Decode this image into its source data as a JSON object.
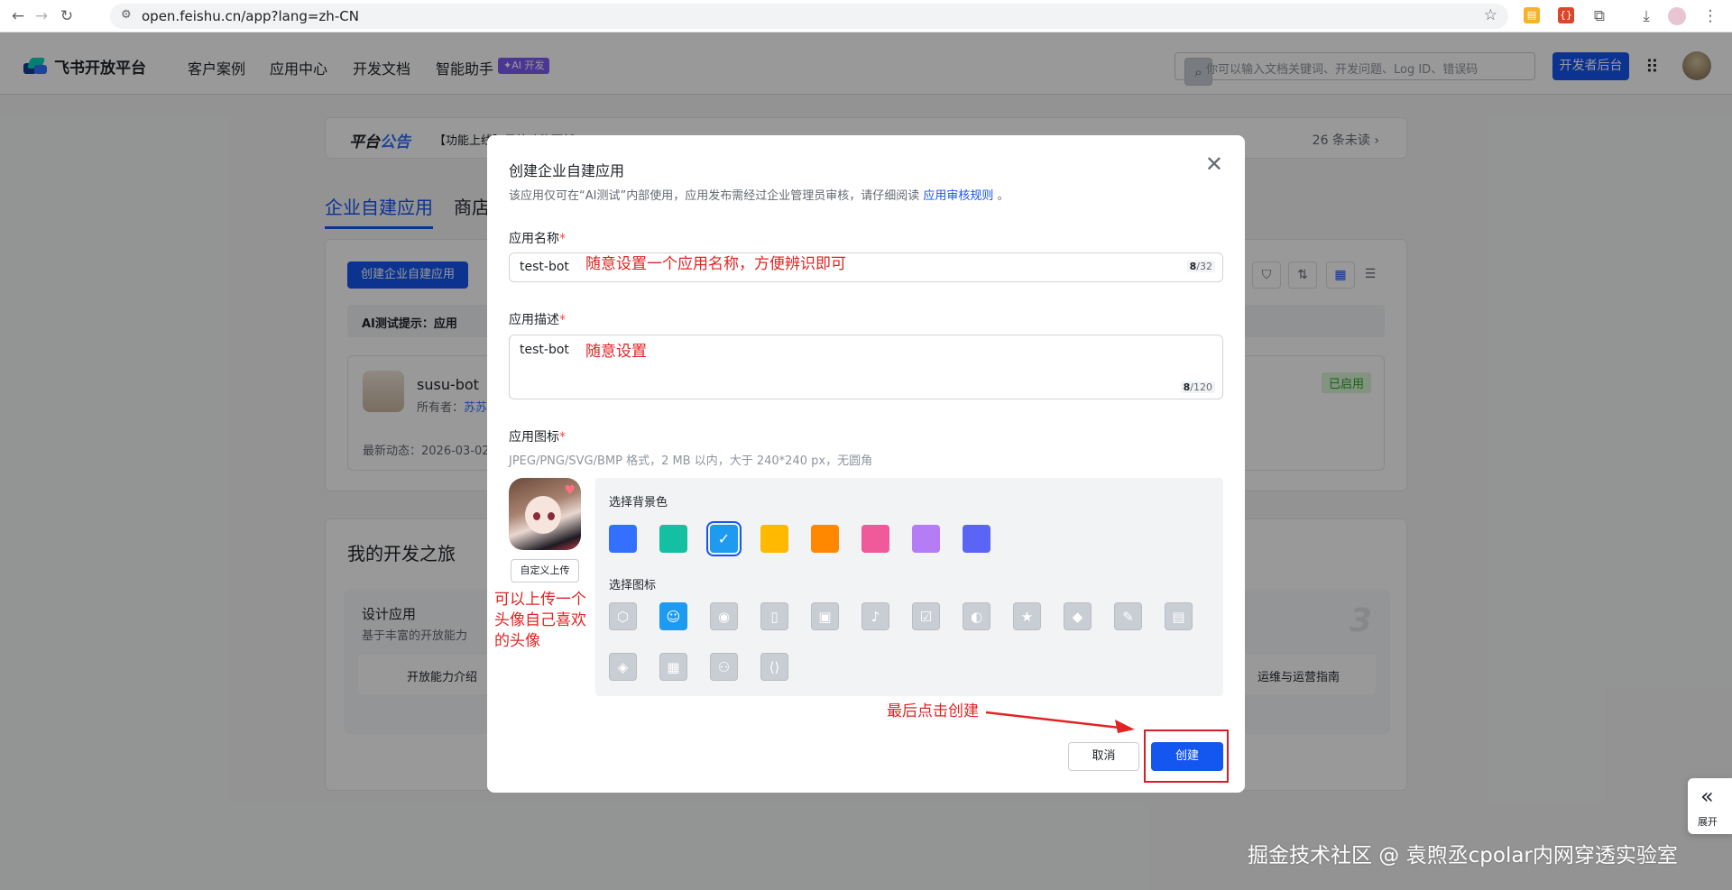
{
  "browser": {
    "url": "open.feishu.cn/app?lang=zh-CN",
    "icons": [
      "back-icon",
      "forward-icon",
      "reload-icon",
      "site-info-icon",
      "bookmark-star-icon",
      "extension-icon",
      "download-icon",
      "menu-icon"
    ]
  },
  "header": {
    "logo_text": "飞书开放平台",
    "nav": [
      "客户案例",
      "应用中心",
      "开发文档",
      "智能助手"
    ],
    "ai_badge": "✦AI 开发",
    "search_placeholder": "你可以输入文档关键词、开发问题、Log ID、错误码",
    "dev_console": "开发者后台"
  },
  "background": {
    "notice_title_a": "平台",
    "notice_title_b": "公告",
    "notice_text": "【功能上线】另外功能更新",
    "notice_count": "26 条未读 ›",
    "tab_active": "企业自建应用",
    "tab_other": "商店",
    "create_button": "创建企业自建应用",
    "tip_text": "AI测试提示：应用",
    "app": {
      "name": "susu-bot",
      "owner_label": "所有者：",
      "owner": "苏苏",
      "date": "最新动态：2026-03-02",
      "status": "已启用"
    },
    "journey_title": "我的开发之旅",
    "design_title": "设计应用",
    "design_desc": "基于丰富的开放能力",
    "link_left": "开放能力介绍",
    "link_right": "运维与运营指南",
    "step": "3"
  },
  "modal": {
    "title": "创建企业自建应用",
    "desc_text": "该应用仅可在“AI测试”内部使用，应用发布需经过企业管理员审核，请仔细阅读",
    "desc_link": "应用审核规则",
    "desc_end": "。",
    "name_label": "应用名称",
    "name_value": "test-bot",
    "name_count_cur": "8",
    "name_count_max": "/32",
    "desc_label": "应用描述",
    "desc_value": "test-bot",
    "desc_count_cur": "8",
    "desc_count_max": "/120",
    "icon_label": "应用图标",
    "icon_hint": "JPEG/PNG/SVG/BMP 格式，2 MB 以内，大于 240*240 px，无圆角",
    "upload_button": "自定义上传",
    "bg_label": "选择背景色",
    "icon_choose_label": "选择图标",
    "cancel": "取消",
    "create": "创建",
    "swatches": [
      "#3370ff",
      "#14c0a1",
      "#1e9bf0",
      "#ffba00",
      "#ff8800",
      "#f05a9a",
      "#b57cf5",
      "#5b65f5"
    ],
    "selected_swatch": 2,
    "selected_icon": "robot-icon",
    "icons": [
      "cube-icon",
      "robot-icon",
      "lightbulb-icon",
      "document-icon",
      "briefcase-icon",
      "bell-icon",
      "checklist-icon",
      "moon-icon",
      "star-icon",
      "tag-icon",
      "wrench-icon",
      "file-icon",
      "shield-icon",
      "layout-icon",
      "people-icon",
      "code-icon"
    ]
  },
  "annotations": {
    "name_note": "随意设置一个应用名称，方便辨识即可",
    "desc_note": "随意设置",
    "upload_note_1": "可以上传一个",
    "upload_note_2": "头像自己喜欢",
    "upload_note_3": "的头像",
    "create_note": "最后点击创建"
  },
  "side": {
    "expand_label": "展开"
  },
  "watermark": "掘金技术社区 @ 袁煦丞cpolar内网穿透实验室",
  "colors": {
    "primary": "#1456f0",
    "annotation": "#e02424",
    "success": "#2ea121"
  }
}
